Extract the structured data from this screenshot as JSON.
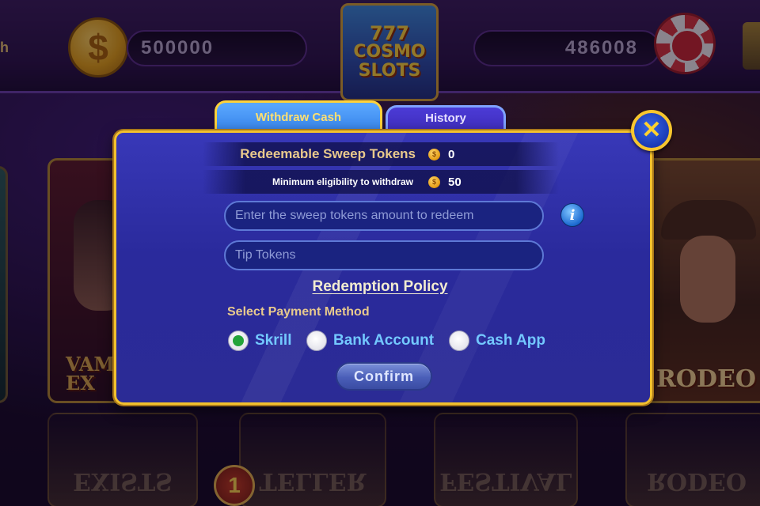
{
  "lobby": {
    "edge_text": "h",
    "coin_balance": "500000",
    "chip_balance": "486008",
    "logo": {
      "line1": "777",
      "line2": "COSMO",
      "line3": "SLOTS"
    },
    "cards": {
      "left_title_line1": "VAM",
      "left_title_line2": "EX",
      "right_title": "RODEO"
    },
    "reflections": [
      "EXISTS",
      "TELLER",
      "FESTIVAL",
      "RODEO"
    ],
    "badge": "1"
  },
  "tabs": [
    {
      "label": "Withdraw Cash",
      "active": true
    },
    {
      "label": "History",
      "active": false
    }
  ],
  "modal": {
    "redeemable_label": "Redeemable Sweep Tokens",
    "redeemable_value": "0",
    "min_label": "Minimum eligibility to withdraw",
    "min_value": "50",
    "token_icon": "$",
    "redeem_placeholder": "Enter the sweep tokens amount to redeem",
    "tip_placeholder": "Tip Tokens",
    "info_icon": "i",
    "policy_link": "Redemption Policy",
    "payment_label": "Select Payment Method",
    "payment_options": [
      {
        "label": "Skrill",
        "selected": true
      },
      {
        "label": "Bank Account",
        "selected": false
      },
      {
        "label": "Cash App",
        "selected": false
      }
    ],
    "confirm_label": "Confirm",
    "close_icon": "✕"
  },
  "colors": {
    "modal_border": "#f2c12e",
    "modal_bg": "#2a2a9c",
    "radio_selected": "#23a33a",
    "option_text": "#73c8ff"
  }
}
